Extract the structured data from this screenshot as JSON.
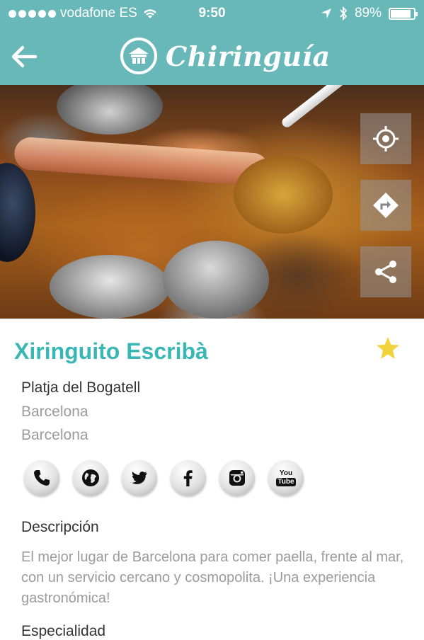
{
  "status_bar": {
    "carrier": "vodafone ES",
    "time": "9:50",
    "battery": "89%",
    "battery_level": 0.89,
    "icons": [
      "signal-dots-icon",
      "wifi-icon",
      "location-arrow-icon",
      "bluetooth-icon",
      "battery-icon"
    ]
  },
  "nav": {
    "back_icon": "back-arrow-icon",
    "brand_icon": "beach-hut-icon",
    "app_name": "Chiringuía"
  },
  "hero": {
    "side_actions": [
      {
        "name": "locate-button",
        "icon": "crosshair-icon"
      },
      {
        "name": "directions-button",
        "icon": "directions-icon"
      },
      {
        "name": "share-button",
        "icon": "share-icon"
      }
    ]
  },
  "place": {
    "name": "Xiringuito Escribà",
    "favorite_icon": "star-icon",
    "address_line": "Platja del Bogatell",
    "city": "Barcelona",
    "province": "Barcelona"
  },
  "social": [
    {
      "name": "phone-button",
      "icon": "phone-icon"
    },
    {
      "name": "web-button",
      "icon": "globe-icon"
    },
    {
      "name": "twitter-button",
      "icon": "twitter-icon"
    },
    {
      "name": "facebook-button",
      "icon": "facebook-icon"
    },
    {
      "name": "instagram-button",
      "icon": "instagram-icon"
    },
    {
      "name": "youtube-button",
      "icon": "youtube-icon",
      "label_top": "You",
      "label_bottom": "Tube"
    }
  ],
  "description": {
    "heading": "Descripción",
    "text": "El mejor lugar de Barcelona para comer paella, frente al mar, con un servicio cercano y cosmopolita. ¡Una experiencia gastronómica!"
  },
  "speciality": {
    "heading": "Especialidad"
  },
  "colors": {
    "bar": "#69b8b9",
    "accent": "#39b7b4",
    "star": "#f2d33b",
    "muted_text": "#9b9b9b"
  }
}
